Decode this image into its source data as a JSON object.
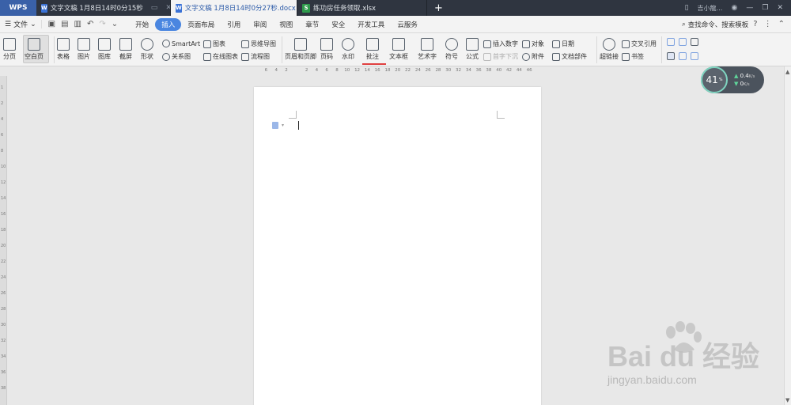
{
  "titlebar": {
    "logo": "WPS",
    "tabs": [
      {
        "label": "文字文稿 1月8日14时0分15秒",
        "type": "doc",
        "active": false
      },
      {
        "label": "文字文稿 1月8日14时0分27秒.docx",
        "type": "doc",
        "active": true
      },
      {
        "label": "练功房任务领取.xlsx",
        "type": "xls",
        "active": false
      }
    ],
    "new_tab": "+",
    "user": "吉小龍…"
  },
  "menubar": {
    "file": "文件",
    "menus": [
      "开始",
      "插入",
      "页面布局",
      "引用",
      "审阅",
      "视图",
      "章节",
      "安全",
      "开发工具",
      "云服务"
    ],
    "active_menu": "插入",
    "search": "查找命令、搜索模板"
  },
  "ribbon": {
    "page_break": "分页",
    "blank_page": "空白页",
    "table": "表格",
    "picture": "图片",
    "gallery": "图库",
    "screenshot": "截屏",
    "shape": "形状",
    "smartart": "SmartArt",
    "chart": "图表",
    "relation": "关系图",
    "online_chart": "在线图表",
    "mindmap": "思维导图",
    "flowchart": "流程图",
    "header_footer": "页眉和页脚",
    "page_number": "页码",
    "watermark": "水印",
    "comment": "批注",
    "textbox": "文本框",
    "wordart": "艺术字",
    "symbol": "符号",
    "formula": "公式",
    "insert_number": "插入数字",
    "dropcap": "首字下沉",
    "object": "对象",
    "attachment": "附件",
    "date": "日期",
    "doc_parts": "文档部件",
    "hyperlink": "超链接",
    "cross_ref": "交叉引用",
    "bookmark": "书签"
  },
  "ruler": {
    "ticks": [
      "6",
      "4",
      "2",
      "",
      "2",
      "4",
      "6",
      "8",
      "10",
      "12",
      "14",
      "16",
      "18",
      "20",
      "22",
      "24",
      "26",
      "28",
      "30",
      "32",
      "34",
      "36",
      "38",
      "40",
      "42",
      "44",
      "46"
    ]
  },
  "vruler": [
    "1",
    "2",
    "4",
    "6",
    "8",
    "10",
    "12",
    "14",
    "16",
    "18",
    "20",
    "22",
    "24",
    "26",
    "28",
    "30",
    "32",
    "34",
    "36",
    "38"
  ],
  "netwidget": {
    "percent": "41",
    "percent_unit": "%",
    "up": "0.4",
    "down": "0",
    "unit": "K/s"
  },
  "watermark": {
    "brand": "Bai  du 经验",
    "url": "jingyan.baidu.com"
  },
  "colors": {
    "titlebar": "#2f3540",
    "accent": "#4a86e0",
    "comment_underline": "#e04040"
  }
}
